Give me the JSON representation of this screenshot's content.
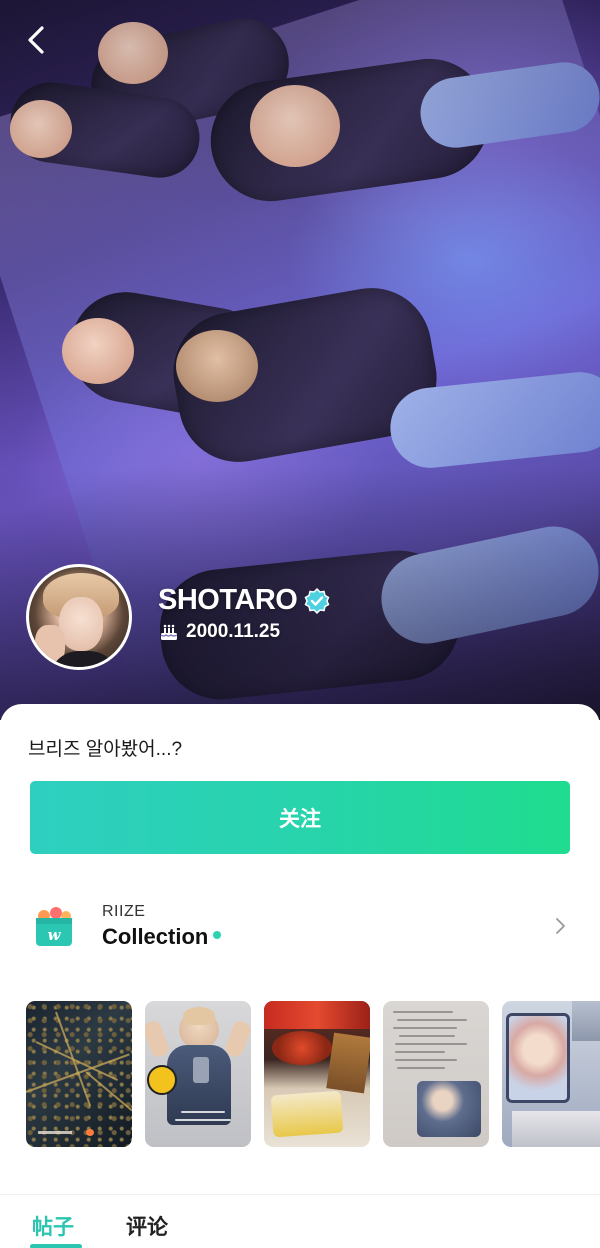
{
  "header": {
    "back_label": "<"
  },
  "profile": {
    "name": "SHOTARO",
    "birthday": "2000.11.25",
    "verified_icon": "verified-badge-icon",
    "birthday_icon": "cake-icon"
  },
  "bio": "브리즈 알아봤어...?",
  "follow_button": {
    "label": "关注",
    "color_start": "#2ecfc0",
    "color_end": "#1fdc8f"
  },
  "collection": {
    "subtitle": "RIIZE",
    "title": "Collection",
    "dot_color": "#2bd3b3"
  },
  "thumbnails": [
    {
      "name": "night-city-photo"
    },
    {
      "name": "selfie-photo"
    },
    {
      "name": "food-photo"
    },
    {
      "name": "message-photo"
    },
    {
      "name": "photocard-photo"
    }
  ],
  "tabs": {
    "posts": "帖子",
    "comments": "评论",
    "active_color": "#2bc5b1"
  }
}
